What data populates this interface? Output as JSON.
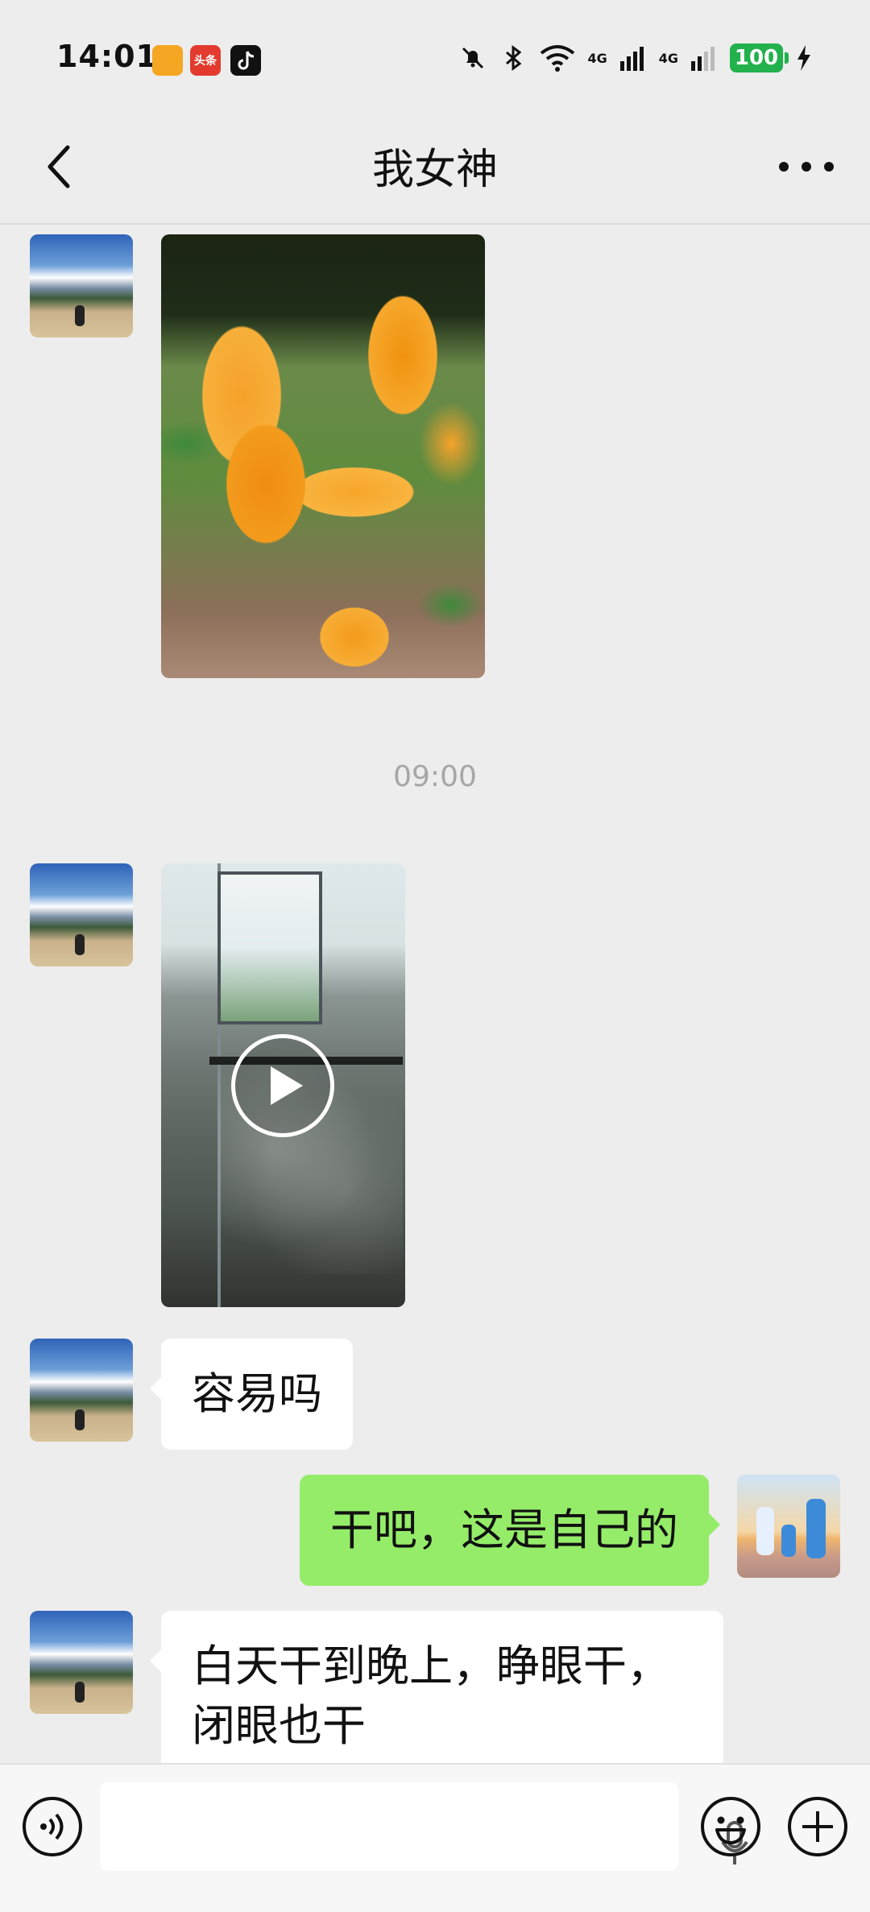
{
  "status_bar": {
    "time": "14:01",
    "app_badge_2": "头条",
    "network_1": "4G",
    "network_2": "4G",
    "battery": "100",
    "icons": [
      "muted-bell-icon",
      "bluetooth-icon",
      "wifi-icon",
      "signal-icon",
      "signal-icon",
      "battery-icon",
      "charging-icon"
    ]
  },
  "header": {
    "title": "我女神",
    "back_icon": "chevron-left-icon",
    "more_icon": "more-dots-icon"
  },
  "messages": {
    "time_divider": "09:00",
    "text_1": "容易吗",
    "text_2": "干吧，这是自己的",
    "text_3": "白天干到晚上，睁眼干，闭眼也干"
  },
  "input_bar": {
    "voice_icon": "voice-input-icon",
    "mic_icon": "microphone-icon",
    "emoji_icon": "emoji-icon",
    "plus_icon": "add-icon"
  },
  "colors": {
    "background": "#ededed",
    "incoming_bubble": "#ffffff",
    "outgoing_bubble": "#95ec69",
    "battery": "#22b14c"
  }
}
